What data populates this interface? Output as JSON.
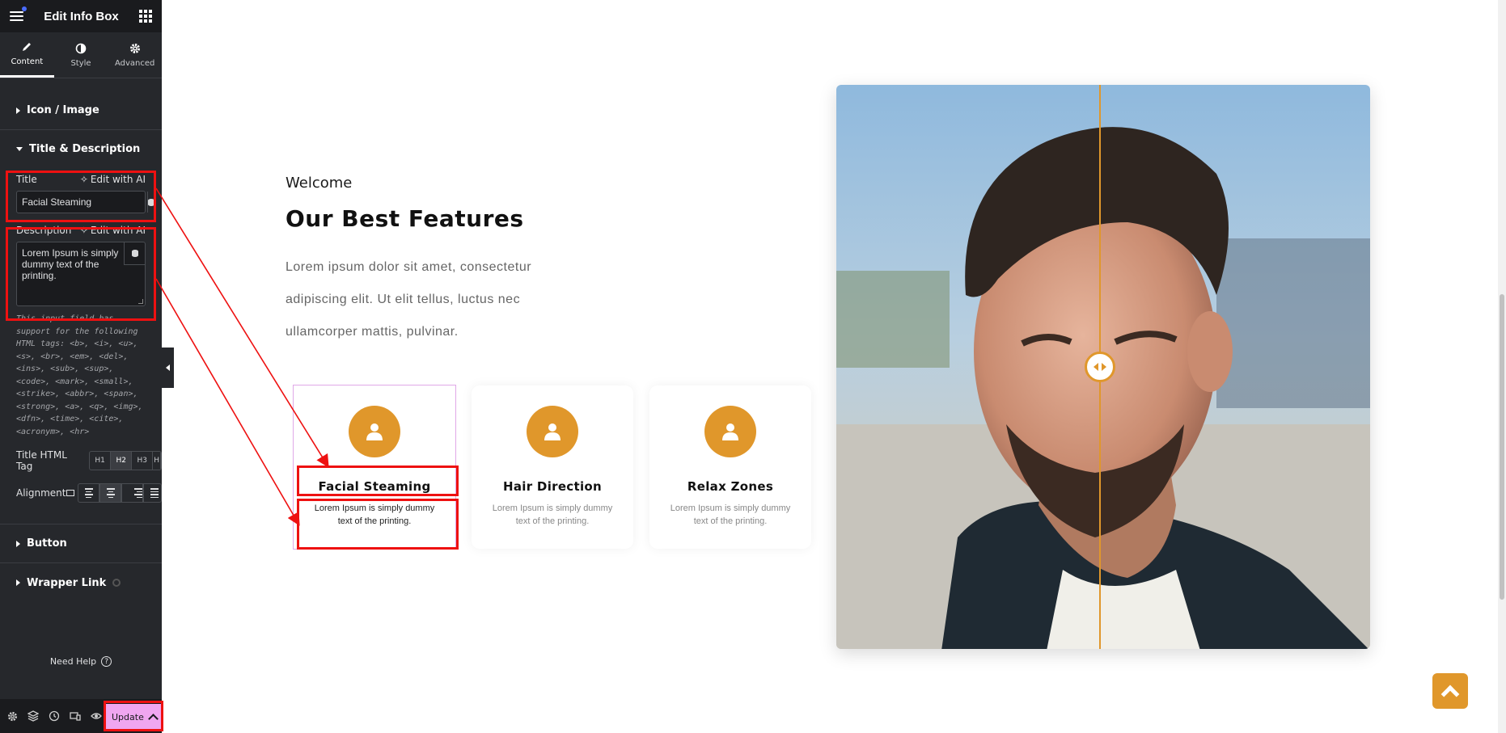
{
  "panel": {
    "title": "Edit Info Box",
    "tabs": [
      {
        "label": "Content",
        "icon": "pencil-icon"
      },
      {
        "label": "Style",
        "icon": "half-circle-icon"
      },
      {
        "label": "Advanced",
        "icon": "gear-icon"
      }
    ],
    "sections": {
      "icon_image": "Icon / Image",
      "title_desc": "Title & Description",
      "button": "Button",
      "wrapper_link": "Wrapper Link"
    },
    "title_field": {
      "label": "Title",
      "ai": "Edit with AI",
      "value": "Facial Steaming"
    },
    "description_field": {
      "label": "Description",
      "ai": "Edit with AI",
      "value": "Lorem Ipsum is simply dummy text of the printing."
    },
    "help_text": "This input field has support for the following HTML tags: <b>, <i>, <u>, <s>, <br>, <em>, <del>, <ins>, <sub>, <sup>, <code>, <mark>, <small>, <strike>, <abbr>, <span>, <strong>, <a>, <q>, <img>, <dfn>, <time>, <cite>, <acronym>, <hr>",
    "html_tag": {
      "label": "Title HTML Tag",
      "options": [
        "H1",
        "H2",
        "H3",
        "H"
      ],
      "selected": "H2"
    },
    "alignment": {
      "label": "Alignment"
    },
    "need_help": "Need Help",
    "update_label": "Update"
  },
  "preview": {
    "welcome": "Welcome",
    "heading": "Our Best Features",
    "paragraph": "Lorem ipsum dolor sit amet, consectetur adipiscing elit. Ut elit tellus, luctus nec ullamcorper mattis, pulvinar.",
    "cards": [
      {
        "title": "Facial Steaming",
        "desc": "Lorem Ipsum is simply dummy text of the printing."
      },
      {
        "title": "Hair Direction",
        "desc": "Lorem Ipsum is simply dummy text of the printing."
      },
      {
        "title": "Relax Zones",
        "desc": "Lorem Ipsum is simply dummy text of the printing."
      }
    ]
  },
  "colors": {
    "accent": "#e0972b",
    "panel_bg": "#26282c",
    "highlight": "#ee1111",
    "update_bg": "#f0a6f0"
  }
}
